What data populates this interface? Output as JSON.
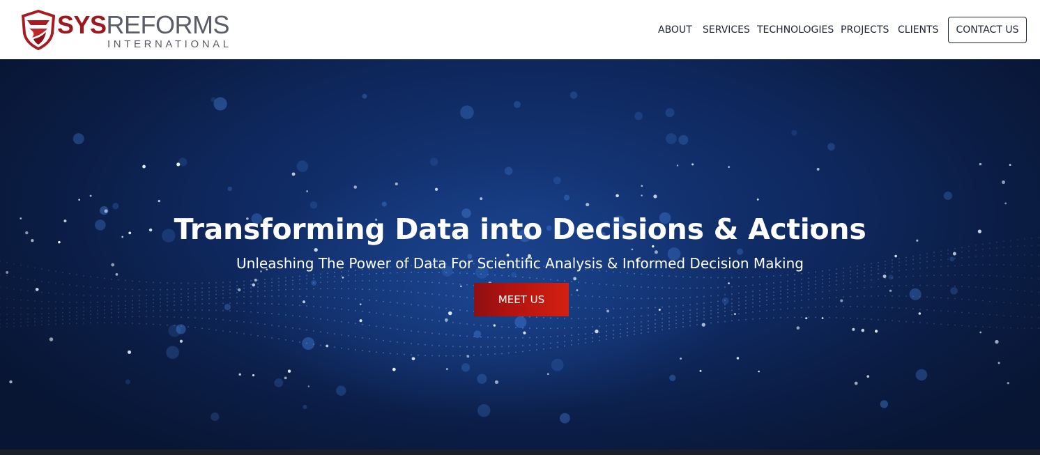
{
  "brand": {
    "name_bold": "SYS",
    "name_light": "REFORMS",
    "subtitle": "INTERNATIONAL",
    "primary_color": "#9b1a1f",
    "secondary_color": "#5a5d66"
  },
  "nav": {
    "items": [
      {
        "label": "ABOUT"
      },
      {
        "label": "SERVICES"
      },
      {
        "label": "TECHNOLOGIES"
      },
      {
        "label": "PROJECTS"
      },
      {
        "label": "CLIENTS"
      }
    ],
    "contact_label": "CONTACT US"
  },
  "hero": {
    "title": "Transforming Data into Decisions & Actions",
    "subtitle": "Unleashing The Power of Data For Scientific Analysis & Informed Decision Making",
    "cta_label": "MEET US",
    "cta_color": "#c0180f",
    "background_color": "#0f2a62",
    "background_icon": "data-particles-background"
  }
}
